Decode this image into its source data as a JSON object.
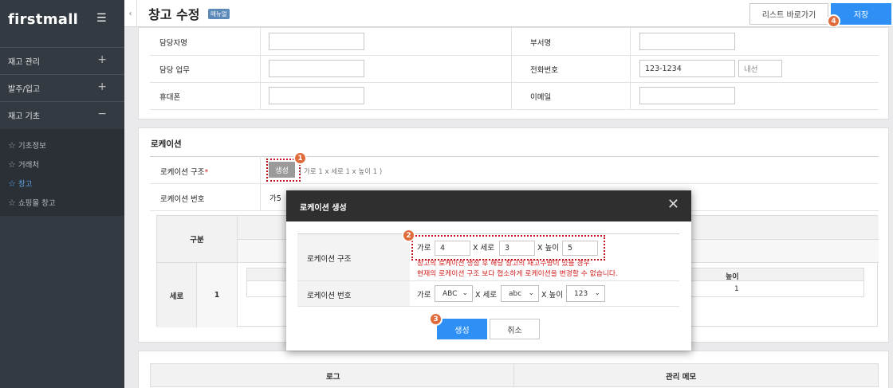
{
  "brand": {
    "logo": "firstmall"
  },
  "sidebar": {
    "menu_icon": "hamburger-icon",
    "sections": [
      {
        "label": "재고 관리",
        "toggle": "+"
      },
      {
        "label": "발주/입고",
        "toggle": "+"
      },
      {
        "label": "재고 기초",
        "toggle": "−"
      }
    ],
    "items": [
      {
        "label": "기초정보",
        "icon": "star-icon"
      },
      {
        "label": "거래처",
        "icon": "star-icon"
      },
      {
        "label": "창고",
        "icon": "star-icon",
        "active": true
      },
      {
        "label": "쇼핑몰 창고",
        "icon": "star-icon"
      }
    ]
  },
  "header": {
    "back": "‹",
    "title": "창고 수정",
    "badge": "매뉴얼",
    "list_button": "리스트 바로가기",
    "save_button": "저장"
  },
  "info": {
    "manager_name_label": "담당자명",
    "dept_label": "부서명",
    "duty_label": "담당 업무",
    "phone_label": "전화번호",
    "phone_value": "123-1234",
    "ext_placeholder": "내선",
    "mobile_label": "휴대폰",
    "email_label": "이메일"
  },
  "location": {
    "section_title": "로케이션",
    "structure_label": "로케이션 구조",
    "required_mark": "*",
    "generate_button": "생성",
    "structure_hint": "( 가로 1 x 세로 1 x 높이 1 )",
    "number_label": "로케이션 번호",
    "number_value_partial": "가5",
    "table": {
      "category_header": "구분",
      "row_header": "세로",
      "row_number": "1",
      "height_header": "높이",
      "height_value": "1"
    }
  },
  "bottom_table": {
    "log_header": "로그",
    "memo_header": "관리 메모"
  },
  "modal": {
    "title": "로케이션 생성",
    "close_icon": "close-icon",
    "structure_label": "로케이션 구조",
    "width_label": "가로",
    "width_value": "4",
    "length_label": "X 세로",
    "length_value": "3",
    "height_label": "X 높이",
    "height_value": "5",
    "warning_line1": "창고의 로케이션 생성 후 해당 창고의 재고수량이 있을 경우",
    "warning_line2": "현재의 로케이션 구조 보다 협소하게 로케이션을 변경할 수 없습니다.",
    "number_label": "로케이션 번호",
    "num_width_label": "가로",
    "num_width_select": "ABC",
    "num_length_label": "X 세로",
    "num_length_select": "abc",
    "num_height_label": "X 높이",
    "num_height_select": "123",
    "create_button": "생성",
    "cancel_button": "취소"
  },
  "markers": [
    "1",
    "2",
    "3",
    "4"
  ],
  "colors": {
    "accent": "#2e90f5",
    "marker": "#e06b3b",
    "warning": "#d41f1f",
    "sidebar": "#343a42"
  }
}
